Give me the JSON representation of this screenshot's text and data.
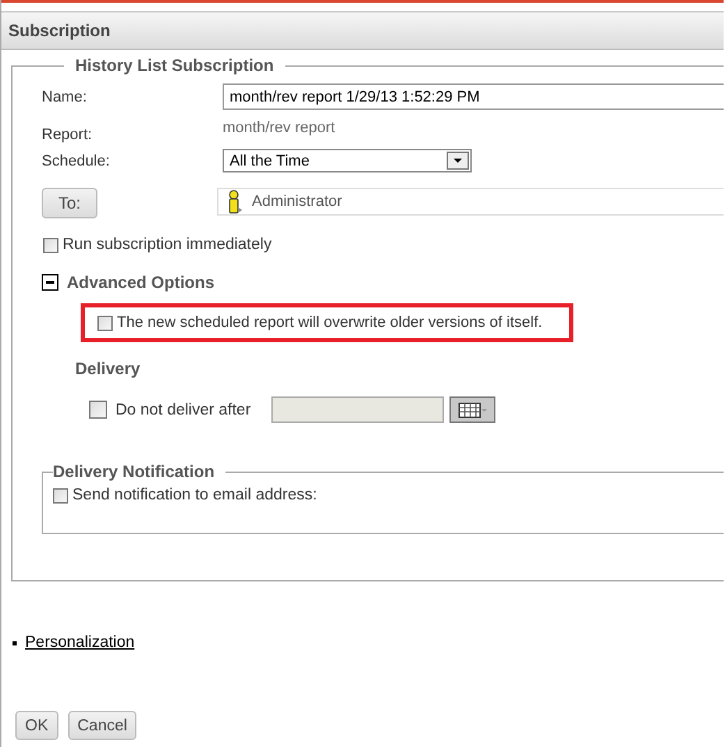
{
  "window": {
    "title": "Subscription"
  },
  "history_section": {
    "legend": "History List Subscription",
    "name": {
      "label": "Name:",
      "value": "month/rev report 1/29/13 1:52:29 PM"
    },
    "report": {
      "label": "Report:",
      "value": "month/rev report"
    },
    "schedule": {
      "label": "Schedule:",
      "value": "All the Time"
    },
    "to": {
      "button": "To:",
      "recipient": "Administrator"
    },
    "run_immediately": {
      "label": "Run subscription immediately",
      "checked": false
    },
    "advanced": {
      "title": "Advanced Options",
      "expanded": true,
      "overwrite": {
        "label": "The new scheduled report will overwrite older versions of itself.",
        "checked": false,
        "highlighted": true
      },
      "delivery": {
        "title": "Delivery",
        "do_not_deliver": {
          "label": "Do not deliver after",
          "checked": false
        }
      }
    },
    "notification": {
      "legend": "Delivery Notification",
      "send_email": {
        "label": "Send notification to email address:",
        "checked": false
      }
    }
  },
  "personalization_link": "Personalization",
  "buttons": [
    "OK",
    "Cancel"
  ]
}
